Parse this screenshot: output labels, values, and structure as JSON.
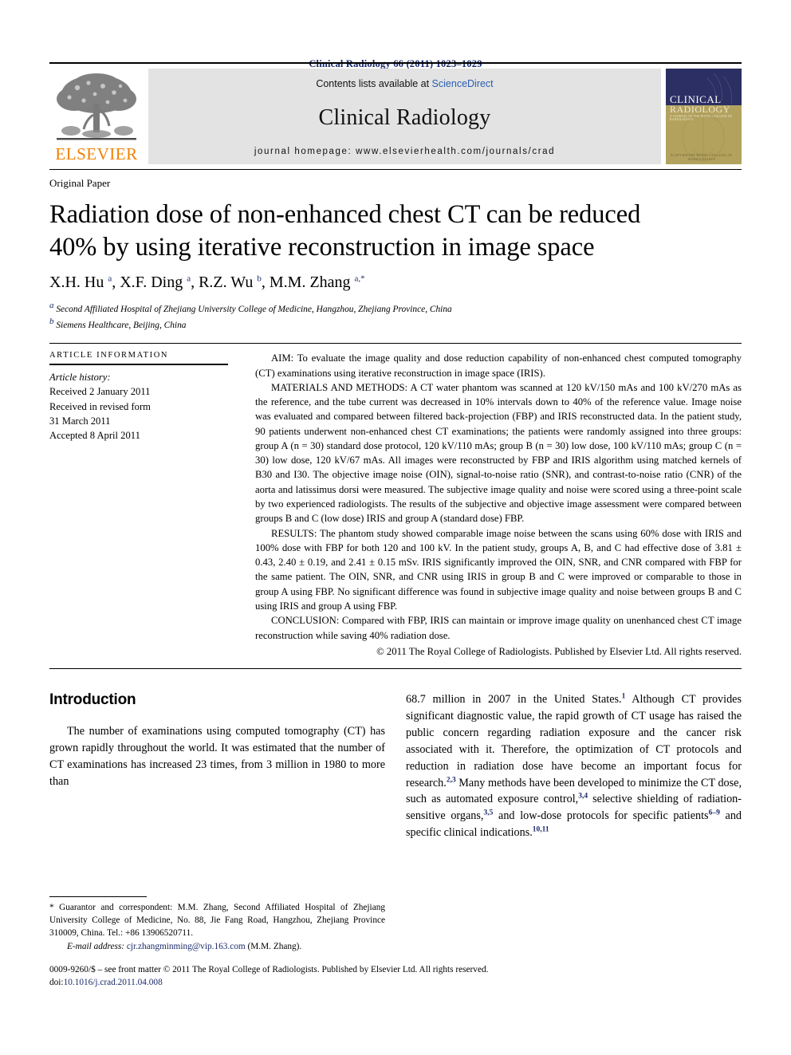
{
  "running_head": "Clinical Radiology 66 (2011) 1023–1029",
  "banner": {
    "publisher_logo_text": "ELSEVIER",
    "contents_prefix": "Contents lists available at ",
    "contents_link": "ScienceDirect",
    "journal_name": "Clinical Radiology",
    "homepage_line": "journal homepage: www.elsevierhealth.com/journals/crad",
    "cover": {
      "title_line1": "CLINICAL",
      "title_line2": "RADIOLOGY",
      "subtitle": "A JOURNAL OF THE ROYAL COLLEGE OF RADIOLOGISTS",
      "footer_left": "ELSEVIER",
      "footer_right": "THE ROYAL COLLEGE OF RADIOLOGISTS"
    }
  },
  "article": {
    "type_label": "Original Paper",
    "title_line1": "Radiation dose of non-enhanced chest CT can be reduced",
    "title_line2": "40% by using iterative reconstruction in image space",
    "authors": "X.H. Hu a, X.F. Ding a, R.Z. Wu b, M.M. Zhang a,*",
    "affiliation_a": "Second Affiliated Hospital of Zhejiang University College of Medicine, Hangzhou, Zhejiang Province, China",
    "affiliation_b": "Siemens Healthcare, Beijing, China"
  },
  "article_information": {
    "heading": "ARTICLE INFORMATION",
    "history_label": "Article history:",
    "lines": [
      "Received 2 January 2011",
      "Received in revised form",
      "31 March 2011",
      "Accepted 8 April 2011"
    ]
  },
  "abstract": {
    "aim": "AIM: To evaluate the image quality and dose reduction capability of non-enhanced chest computed tomography (CT) examinations using iterative reconstruction in image space (IRIS).",
    "materials_and_methods": "MATERIALS AND METHODS: A CT water phantom was scanned at 120 kV/150 mAs and 100 kV/270 mAs as the reference, and the tube current was decreased in 10% intervals down to 40% of the reference value. Image noise was evaluated and compared between filtered back-projection (FBP) and IRIS reconstructed data. In the patient study, 90 patients underwent non-enhanced chest CT examinations; the patients were randomly assigned into three groups: group A (n = 30) standard dose protocol, 120 kV/110 mAs; group B (n = 30) low dose, 100 kV/110 mAs; group C (n = 30) low dose, 120 kV/67 mAs. All images were reconstructed by FBP and IRIS algorithm using matched kernels of B30 and I30. The objective image noise (OIN), signal-to-noise ratio (SNR), and contrast-to-noise ratio (CNR) of the aorta and latissimus dorsi were measured. The subjective image quality and noise were scored using a three-point scale by two experienced radiologists. The results of the subjective and objective image assessment were compared between groups B and C (low dose) IRIS and group A (standard dose) FBP.",
    "results": "RESULTS: The phantom study showed comparable image noise between the scans using 60% dose with IRIS and 100% dose with FBP for both 120 and 100 kV. In the patient study, groups A, B, and C had effective dose of 3.81 ± 0.43, 2.40 ± 0.19, and 2.41 ± 0.15 mSv. IRIS significantly improved the OIN, SNR, and CNR compared with FBP for the same patient. The OIN, SNR, and CNR using IRIS in group B and C were improved or comparable to those in group A using FBP. No significant difference was found in subjective image quality and noise between groups B and C using IRIS and group A using FBP.",
    "conclusion": "CONCLUSION: Compared with FBP, IRIS can maintain or improve image quality on unenhanced chest CT image reconstruction while saving 40% radiation dose.",
    "copyright": "© 2011 The Royal College of Radiologists. Published by Elsevier Ltd. All rights reserved."
  },
  "body": {
    "section_heading": "Introduction",
    "left_paragraph": "The number of examinations using computed tomography (CT) has grown rapidly throughout the world. It was estimated that the number of CT examinations has increased 23 times, from 3 million in 1980 to more than",
    "right_paragraph_part1": "68.7 million in 2007 in the United States.",
    "right_ref1": "1",
    "right_paragraph_part2": " Although CT provides significant diagnostic value, the rapid growth of CT usage has raised the public concern regarding radiation exposure and the cancer risk associated with it. Therefore, the optimization of CT protocols and reduction in radiation dose have become an important focus for research.",
    "right_ref2": "2,3",
    "right_paragraph_part3": " Many methods have been developed to minimize the CT dose, such as automated exposure control,",
    "right_ref3": "3,4",
    "right_paragraph_part4": " selective shielding of radiation-sensitive organs,",
    "right_ref4": "3,5",
    "right_paragraph_part5": " and low-dose protocols for specific patients",
    "right_ref5": "6–9",
    "right_paragraph_part6": " and specific clinical indications.",
    "right_ref6": "10,11"
  },
  "footnotes": {
    "correspondence": "* Guarantor and correspondent: M.M. Zhang, Second Affiliated Hospital of Zhejiang University College of Medicine, No. 88, Jie Fang Road, Hangzhou, Zhejiang Province 310009, China. Tel.: +86 13906520711.",
    "email_label": "E-mail address:",
    "email_link": "cjr.zhangminming@vip.163.com",
    "email_suffix": " (M.M. Zhang)."
  },
  "footer": {
    "front_matter": "0009-9260/$ – see front matter © 2011 The Royal College of Radiologists. Published by Elsevier Ltd. All rights reserved.",
    "doi_label": "doi:",
    "doi_value": "10.1016/j.crad.2011.04.008"
  },
  "colors": {
    "running_head": "#1b2a6b",
    "link": "#1b2a6b",
    "sciencedirect": "#2a5db0",
    "elsevier_orange": "#F08000",
    "banner_gray": "#e3e3e3",
    "cover_navy": "#2b2f63",
    "cover_olive": "#b3a25e"
  }
}
